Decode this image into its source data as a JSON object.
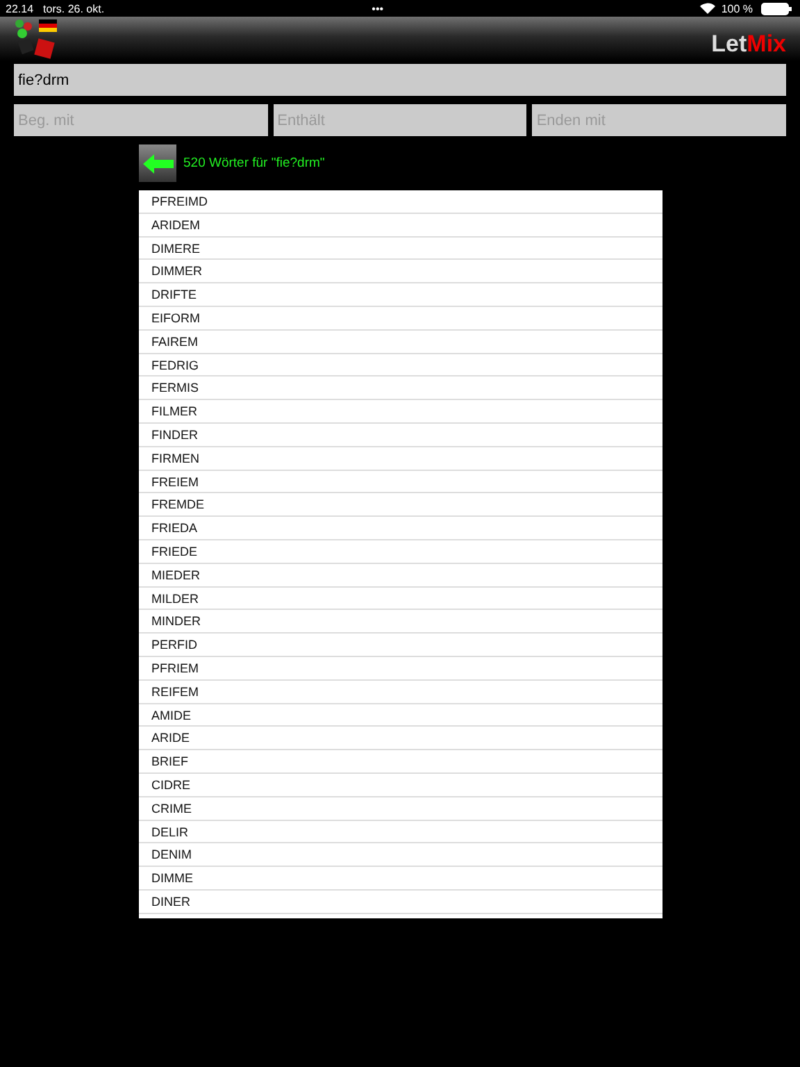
{
  "status_bar": {
    "time": "22.14",
    "date": "tors. 26. okt.",
    "dots": "•••",
    "battery": "100 %"
  },
  "header": {
    "logo_first": "Let",
    "logo_second": "Mix"
  },
  "search": {
    "value": "fie?drm"
  },
  "filters": [
    {
      "placeholder": "Beg. mit"
    },
    {
      "placeholder": "Enthält"
    },
    {
      "placeholder": "Enden mit"
    }
  ],
  "result_title": "520 Wörter für \"fie?drm\"",
  "words": [
    "PFREIMD",
    "ARIDEM",
    "DIMERE",
    "DIMMER",
    "DRIFTE",
    "EIFORM",
    "FAIREM",
    "FEDRIG",
    "FERMIS",
    "FILMER",
    "FINDER",
    "FIRMEN",
    "FREIEM",
    "FREMDE",
    "FRIEDA",
    "FRIEDE",
    "MIEDER",
    "MILDER",
    "MINDER",
    "PERFID",
    "PFRIEM",
    "REIFEM",
    "AMIDE",
    "ARIDE",
    "BRIEF",
    "CIDRE",
    "CRIME",
    "DELIR",
    "DENIM",
    "DIMME",
    "DINER"
  ]
}
